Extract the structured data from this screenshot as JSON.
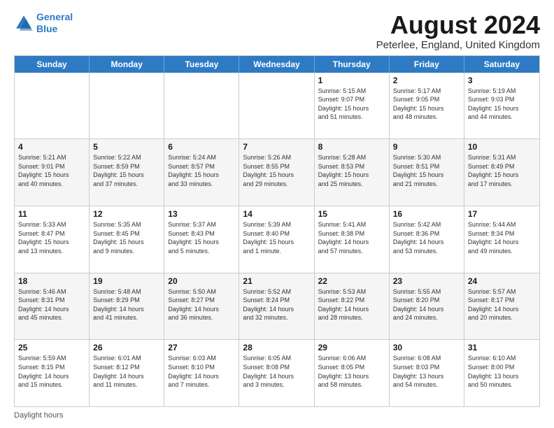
{
  "logo": {
    "line1": "General",
    "line2": "Blue"
  },
  "title": "August 2024",
  "location": "Peterlee, England, United Kingdom",
  "days_of_week": [
    "Sunday",
    "Monday",
    "Tuesday",
    "Wednesday",
    "Thursday",
    "Friday",
    "Saturday"
  ],
  "footer_label": "Daylight hours",
  "weeks": [
    [
      {
        "day": "",
        "info": ""
      },
      {
        "day": "",
        "info": ""
      },
      {
        "day": "",
        "info": ""
      },
      {
        "day": "",
        "info": ""
      },
      {
        "day": "1",
        "info": "Sunrise: 5:15 AM\nSunset: 9:07 PM\nDaylight: 15 hours\nand 51 minutes."
      },
      {
        "day": "2",
        "info": "Sunrise: 5:17 AM\nSunset: 9:05 PM\nDaylight: 15 hours\nand 48 minutes."
      },
      {
        "day": "3",
        "info": "Sunrise: 5:19 AM\nSunset: 9:03 PM\nDaylight: 15 hours\nand 44 minutes."
      }
    ],
    [
      {
        "day": "4",
        "info": "Sunrise: 5:21 AM\nSunset: 9:01 PM\nDaylight: 15 hours\nand 40 minutes."
      },
      {
        "day": "5",
        "info": "Sunrise: 5:22 AM\nSunset: 8:59 PM\nDaylight: 15 hours\nand 37 minutes."
      },
      {
        "day": "6",
        "info": "Sunrise: 5:24 AM\nSunset: 8:57 PM\nDaylight: 15 hours\nand 33 minutes."
      },
      {
        "day": "7",
        "info": "Sunrise: 5:26 AM\nSunset: 8:55 PM\nDaylight: 15 hours\nand 29 minutes."
      },
      {
        "day": "8",
        "info": "Sunrise: 5:28 AM\nSunset: 8:53 PM\nDaylight: 15 hours\nand 25 minutes."
      },
      {
        "day": "9",
        "info": "Sunrise: 5:30 AM\nSunset: 8:51 PM\nDaylight: 15 hours\nand 21 minutes."
      },
      {
        "day": "10",
        "info": "Sunrise: 5:31 AM\nSunset: 8:49 PM\nDaylight: 15 hours\nand 17 minutes."
      }
    ],
    [
      {
        "day": "11",
        "info": "Sunrise: 5:33 AM\nSunset: 8:47 PM\nDaylight: 15 hours\nand 13 minutes."
      },
      {
        "day": "12",
        "info": "Sunrise: 5:35 AM\nSunset: 8:45 PM\nDaylight: 15 hours\nand 9 minutes."
      },
      {
        "day": "13",
        "info": "Sunrise: 5:37 AM\nSunset: 8:43 PM\nDaylight: 15 hours\nand 5 minutes."
      },
      {
        "day": "14",
        "info": "Sunrise: 5:39 AM\nSunset: 8:40 PM\nDaylight: 15 hours\nand 1 minute."
      },
      {
        "day": "15",
        "info": "Sunrise: 5:41 AM\nSunset: 8:38 PM\nDaylight: 14 hours\nand 57 minutes."
      },
      {
        "day": "16",
        "info": "Sunrise: 5:42 AM\nSunset: 8:36 PM\nDaylight: 14 hours\nand 53 minutes."
      },
      {
        "day": "17",
        "info": "Sunrise: 5:44 AM\nSunset: 8:34 PM\nDaylight: 14 hours\nand 49 minutes."
      }
    ],
    [
      {
        "day": "18",
        "info": "Sunrise: 5:46 AM\nSunset: 8:31 PM\nDaylight: 14 hours\nand 45 minutes."
      },
      {
        "day": "19",
        "info": "Sunrise: 5:48 AM\nSunset: 8:29 PM\nDaylight: 14 hours\nand 41 minutes."
      },
      {
        "day": "20",
        "info": "Sunrise: 5:50 AM\nSunset: 8:27 PM\nDaylight: 14 hours\nand 36 minutes."
      },
      {
        "day": "21",
        "info": "Sunrise: 5:52 AM\nSunset: 8:24 PM\nDaylight: 14 hours\nand 32 minutes."
      },
      {
        "day": "22",
        "info": "Sunrise: 5:53 AM\nSunset: 8:22 PM\nDaylight: 14 hours\nand 28 minutes."
      },
      {
        "day": "23",
        "info": "Sunrise: 5:55 AM\nSunset: 8:20 PM\nDaylight: 14 hours\nand 24 minutes."
      },
      {
        "day": "24",
        "info": "Sunrise: 5:57 AM\nSunset: 8:17 PM\nDaylight: 14 hours\nand 20 minutes."
      }
    ],
    [
      {
        "day": "25",
        "info": "Sunrise: 5:59 AM\nSunset: 8:15 PM\nDaylight: 14 hours\nand 15 minutes."
      },
      {
        "day": "26",
        "info": "Sunrise: 6:01 AM\nSunset: 8:12 PM\nDaylight: 14 hours\nand 11 minutes."
      },
      {
        "day": "27",
        "info": "Sunrise: 6:03 AM\nSunset: 8:10 PM\nDaylight: 14 hours\nand 7 minutes."
      },
      {
        "day": "28",
        "info": "Sunrise: 6:05 AM\nSunset: 8:08 PM\nDaylight: 14 hours\nand 3 minutes."
      },
      {
        "day": "29",
        "info": "Sunrise: 6:06 AM\nSunset: 8:05 PM\nDaylight: 13 hours\nand 58 minutes."
      },
      {
        "day": "30",
        "info": "Sunrise: 6:08 AM\nSunset: 8:03 PM\nDaylight: 13 hours\nand 54 minutes."
      },
      {
        "day": "31",
        "info": "Sunrise: 6:10 AM\nSunset: 8:00 PM\nDaylight: 13 hours\nand 50 minutes."
      }
    ]
  ]
}
